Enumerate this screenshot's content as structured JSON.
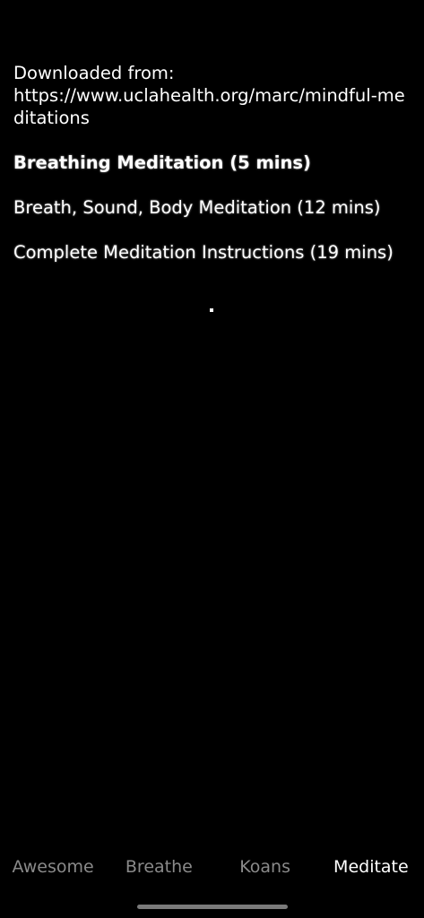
{
  "source": {
    "label": "Downloaded from:",
    "url": "https://www.uclahealth.org/marc/mindful-meditations"
  },
  "meditations": [
    {
      "title": "Breathing Meditation (5 mins)",
      "active": true
    },
    {
      "title": "Breath, Sound, Body Meditation (12 mins)",
      "active": false
    },
    {
      "title": "Complete Meditation Instructions (19 mins)",
      "active": false
    }
  ],
  "status_indicator": ".",
  "tabs": [
    {
      "label": "Awesome",
      "active": false
    },
    {
      "label": "Breathe",
      "active": false
    },
    {
      "label": "Koans",
      "active": false
    },
    {
      "label": "Meditate",
      "active": true
    }
  ],
  "colors": {
    "background": "#000000",
    "text": "#ffffff",
    "inactive_tab": "#8a8a8a"
  }
}
